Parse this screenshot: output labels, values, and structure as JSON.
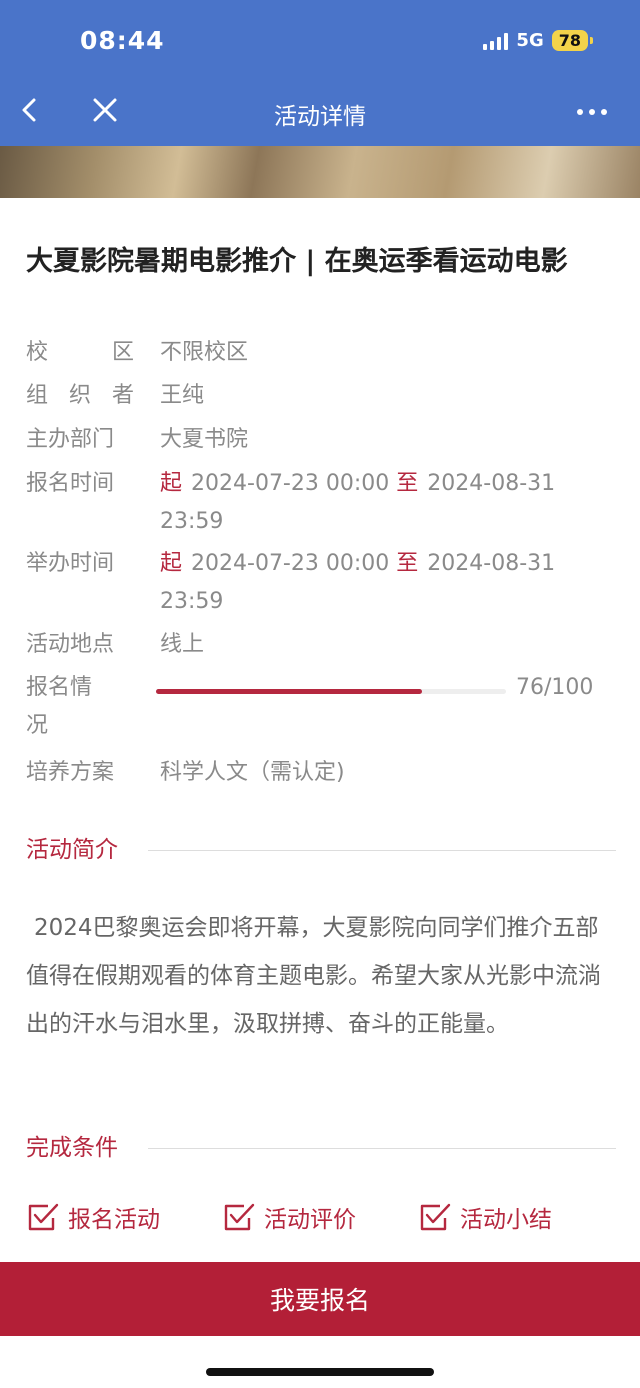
{
  "status_bar": {
    "time": "08:44",
    "network": "5G",
    "battery": "78"
  },
  "nav": {
    "title": "活动详情",
    "back_icon": "chevron-left-icon",
    "close_icon": "close-icon",
    "more_icon": "more-dots-icon"
  },
  "activity": {
    "title": "大夏影院暑期电影推介 | 在奥运季看运动电影",
    "campus": {
      "label_chars": [
        "校",
        "区"
      ],
      "value": "不限校区"
    },
    "organizer": {
      "label_chars": [
        "组",
        "织",
        "者"
      ],
      "value": "王纯"
    },
    "host_dept": {
      "label": "主办部门",
      "value": "大夏书院"
    },
    "signup_time": {
      "label": "报名时间",
      "start_tag": "起",
      "start": "2024-07-23 00:00",
      "end_tag": "至",
      "end": "2024-08-31 23:59"
    },
    "hold_time": {
      "label": "举办时间",
      "start_tag": "起",
      "start": "2024-07-23 00:00",
      "end_tag": "至",
      "end": "2024-08-31 23:59"
    },
    "location": {
      "label": "活动地点",
      "value": "线上"
    },
    "signup_status": {
      "label": "报名情况",
      "text": "76/100",
      "fraction": 0.76
    },
    "program": {
      "label": "培养方案",
      "value": "科学人文（需认定)"
    }
  },
  "intro": {
    "heading": "活动简介",
    "text": "2024巴黎奥运会即将开幕，大夏影院向同学们推介五部值得在假期观看的体育主题电影。希望大家从光影中流淌出的汗水与泪水里，汲取拼搏、奋斗的正能量。"
  },
  "conditions": {
    "heading": "完成条件",
    "items": [
      {
        "label": "报名活动",
        "icon": "edit-check-icon"
      },
      {
        "label": "活动评价",
        "icon": "edit-check-icon"
      },
      {
        "label": "活动小结",
        "icon": "edit-check-icon"
      }
    ]
  },
  "signup_button": {
    "label": "我要报名"
  },
  "colors": {
    "nav_bg": "#4a74c9",
    "accent": "#b5283f",
    "button_bg": "#b31f37",
    "battery": "#f3d34a"
  }
}
